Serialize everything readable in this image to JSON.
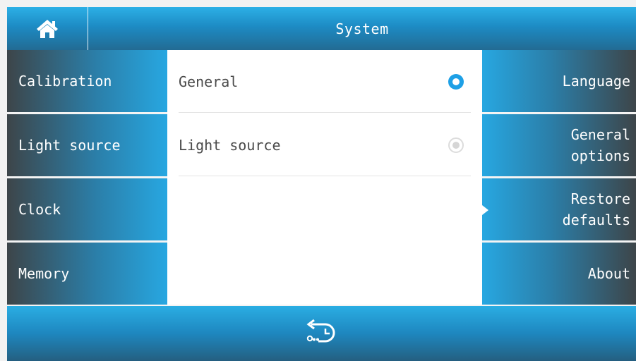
{
  "header": {
    "title": "System",
    "home_icon": "home-icon"
  },
  "left_menu": [
    {
      "label": "Calibration"
    },
    {
      "label": "Light source"
    },
    {
      "label": "Clock"
    },
    {
      "label": "Memory"
    }
  ],
  "options": [
    {
      "label": "General",
      "selected": true
    },
    {
      "label": "Light source",
      "selected": false
    }
  ],
  "right_menu": [
    {
      "label": "Language"
    },
    {
      "label": "General\noptions"
    },
    {
      "label": "Restore\ndefaults"
    },
    {
      "label": "About"
    }
  ],
  "footer": {
    "back_icon": "back-timer-icon"
  },
  "colors": {
    "accent": "#27a7e1",
    "dark": "#3d4549",
    "radio_on": "#1ea0e6"
  }
}
